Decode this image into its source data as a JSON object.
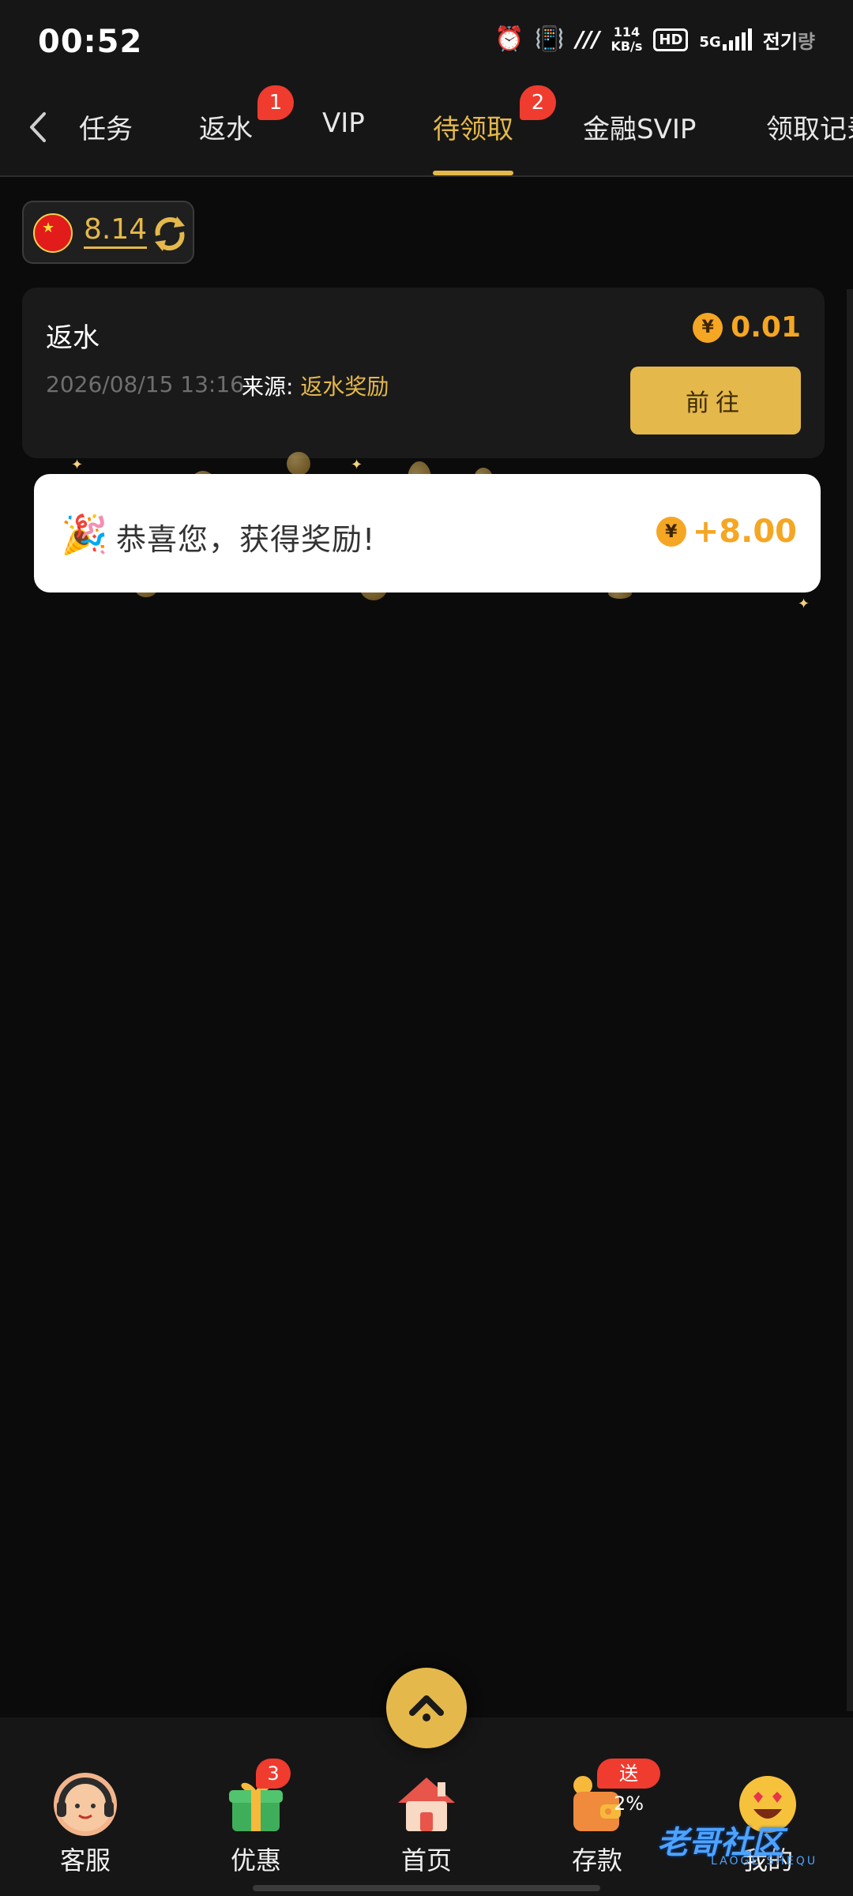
{
  "status_bar": {
    "time": "00:52",
    "speed_value": "114",
    "speed_unit": "KB/s",
    "hd": "HD",
    "network": "5G",
    "carrier": "전기",
    "carrier_dim": "량"
  },
  "tabs": [
    {
      "label": "任务"
    },
    {
      "label": "返水",
      "badge": "1"
    },
    {
      "label": "VIP"
    },
    {
      "label": "待领取",
      "badge": "2",
      "active": true
    },
    {
      "label": "金融SVIP"
    },
    {
      "label": "领取记录"
    }
  ],
  "balance": {
    "amount": "8.14"
  },
  "reward_card": {
    "title": "返水",
    "amount": "0.01",
    "currency_symbol": "¥",
    "date": "2026/08/15 13:16",
    "source_label": "来源:",
    "source_value": "返水奖励",
    "go_button": "前往"
  },
  "toast": {
    "message": "恭喜您，获得奖励!",
    "amount": "+8.00",
    "currency_symbol": "¥"
  },
  "bottom_nav": [
    {
      "label": "客服",
      "icon": "customer-service-icon"
    },
    {
      "label": "优惠",
      "icon": "gift-icon",
      "badge": "3"
    },
    {
      "label": "首页",
      "icon": "home-icon"
    },
    {
      "label": "存款",
      "icon": "wallet-icon",
      "badge": "送2%"
    },
    {
      "label": "我的",
      "icon": "smiley-icon"
    }
  ],
  "watermark": {
    "text": "老哥社区",
    "sub": "LAOGE SHEQU"
  },
  "colors": {
    "accent_gold": "#e4b84a",
    "amount_orange": "#f5a623",
    "badge_red": "#f03b2f",
    "background": "#0b0b0b"
  }
}
